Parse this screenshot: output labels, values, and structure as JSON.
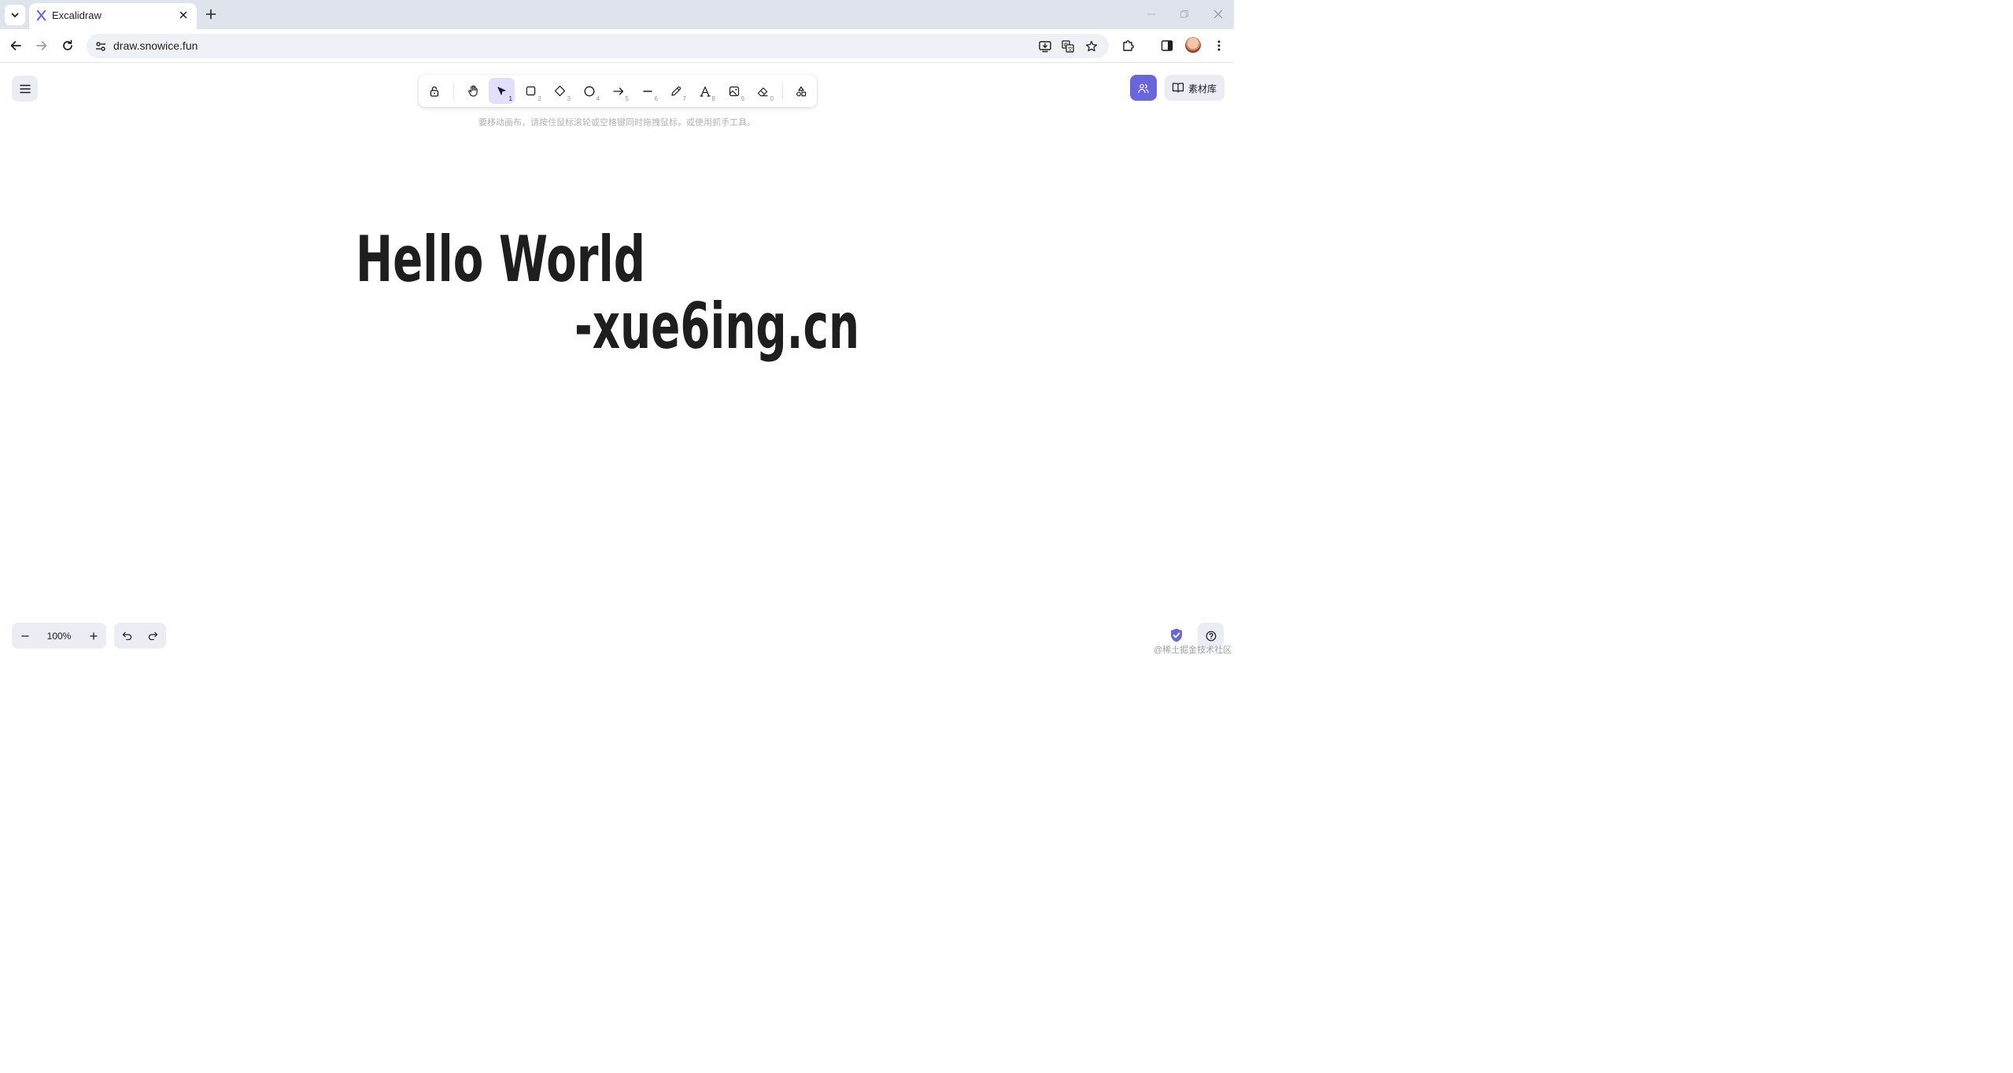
{
  "browser": {
    "tab_title": "Excalidraw",
    "url": "draw.snowice.fun"
  },
  "app": {
    "accent_color": "#6965db",
    "toolbar": {
      "tools": [
        {
          "name": "lock",
          "icon": "lock-open-icon",
          "key": ""
        },
        {
          "name": "hand",
          "icon": "hand-icon",
          "key": ""
        },
        {
          "name": "selection",
          "icon": "pointer-icon",
          "key": "1",
          "active": true
        },
        {
          "name": "rectangle",
          "icon": "square-icon",
          "key": "2"
        },
        {
          "name": "diamond",
          "icon": "diamond-icon",
          "key": "3"
        },
        {
          "name": "ellipse",
          "icon": "circle-icon",
          "key": "4"
        },
        {
          "name": "arrow",
          "icon": "arrow-right-icon",
          "key": "5"
        },
        {
          "name": "line",
          "icon": "line-icon",
          "key": "6"
        },
        {
          "name": "draw",
          "icon": "pencil-icon",
          "key": "7"
        },
        {
          "name": "text",
          "icon": "text-icon",
          "key": "8"
        },
        {
          "name": "image",
          "icon": "image-icon",
          "key": "9"
        },
        {
          "name": "eraser",
          "icon": "eraser-icon",
          "key": "0"
        },
        {
          "name": "more-shapes",
          "icon": "shapes-icon",
          "key": ""
        }
      ]
    },
    "hint": "要移动画布，请按住鼠标滚轮或空格键同时拖拽鼠标，或使用抓手工具。",
    "library_label": "素材库",
    "canvas_text": {
      "line1": "Hello World",
      "line2": "-xue6ing.cn"
    },
    "zoom": "100%",
    "watermark": "@稀土掘金技术社区"
  }
}
